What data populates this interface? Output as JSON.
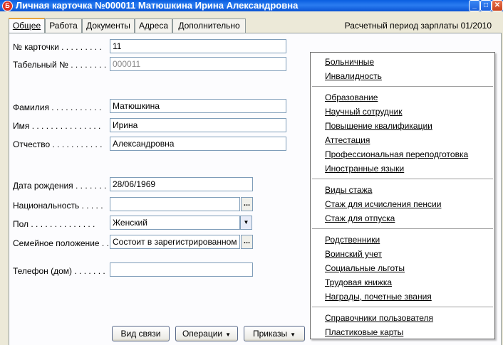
{
  "window": {
    "title": "Личная карточка №000011 Матюшкина Ирина Александровна",
    "app_icon": "app-logo-icon",
    "controls": [
      "minimize-icon",
      "maximize-icon",
      "close-icon"
    ],
    "colors": {
      "titlebar": "#0a5ee0",
      "close": "#c8401a",
      "tab_accent": "#e6a43c"
    }
  },
  "tabs": [
    "Общее",
    "Работа",
    "Документы",
    "Адреса",
    "Дополнительно"
  ],
  "period": "Расчетный период зарплаты 01/2010",
  "form": {
    "card_no": {
      "label": "№ карточки . . . . . . . . .",
      "value": "11"
    },
    "tab_no": {
      "label": "Табельный № . . . . . . . .",
      "value": "000011"
    },
    "last_name": {
      "label": "Фамилия . . . . . . . . . . .",
      "value": "Матюшкина"
    },
    "first_name": {
      "label": "Имя . . . . . . . . . . . . . . .",
      "value": "Ирина"
    },
    "patronymic": {
      "label": "Отчество . . . . . . . . . . .",
      "value": "Александровна"
    },
    "birth_date": {
      "label": "Дата рождения . . . . . . .",
      "value": "28/06/1969"
    },
    "nationality": {
      "label": "Национальность . . . . .",
      "value": "",
      "button": "..."
    },
    "gender": {
      "label": "Пол . . . . . . . . . . . . . .",
      "value": "Женский"
    },
    "marital": {
      "label": "Семейное положение . .",
      "value": "Состоит в зарегистрированном",
      "button": "..."
    },
    "phone": {
      "label": "Телефон (дом) . . . . . . .",
      "value": ""
    }
  },
  "buttons": {
    "contact": "Вид связи",
    "operations": "Операции",
    "orders": "Приказы"
  },
  "menu": {
    "groups": [
      [
        "Больничные",
        "Инвалидность"
      ],
      [
        "Образование",
        "Научный сотрудник",
        "Повышение квалификации",
        "Аттестация",
        "Профессиональная переподготовка",
        "Иностранные языки"
      ],
      [
        "Виды стажа",
        "Стаж для исчисления пенсии",
        "Стаж для отпуска"
      ],
      [
        "Родственники",
        "Воинский учет",
        "Социальные льготы",
        "Трудовая книжка",
        "Награды, почетные звания"
      ],
      [
        "Справочники пользователя",
        "Пластиковые карты"
      ]
    ]
  }
}
